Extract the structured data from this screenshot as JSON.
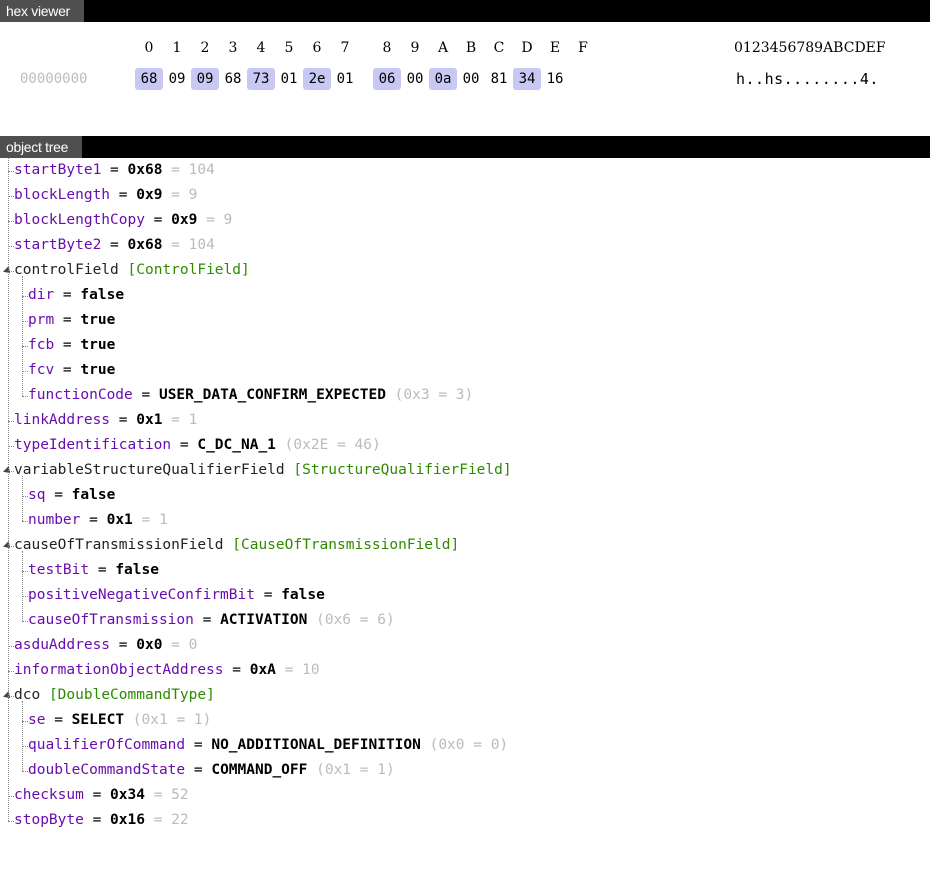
{
  "hex_viewer": {
    "title": "hex viewer",
    "columns": [
      "0",
      "1",
      "2",
      "3",
      "4",
      "5",
      "6",
      "7",
      "8",
      "9",
      "A",
      "B",
      "C",
      "D",
      "E",
      "F"
    ],
    "ascii_header": "0123456789ABCDEF",
    "offset": "00000000",
    "bytes": [
      "68",
      "09",
      "09",
      "68",
      "73",
      "01",
      "2e",
      "01",
      "06",
      "00",
      "0a",
      "00",
      "81",
      "34",
      "16"
    ],
    "ascii": "h..hs........4."
  },
  "object_tree": {
    "title": "object tree",
    "nodes": [
      {
        "key": "startByte1",
        "eq": " = ",
        "val": "0x68",
        "num": " = 104"
      },
      {
        "key": "blockLength",
        "eq": " = ",
        "val": "0x9",
        "num": " = 9"
      },
      {
        "key": "blockLengthCopy",
        "eq": " = ",
        "val": "0x9",
        "num": " = 9"
      },
      {
        "key": "startByte2",
        "eq": " = ",
        "val": "0x68",
        "num": " = 104"
      },
      {
        "key": "controlField",
        "type": "[ControlField]"
      },
      {
        "key": "dir",
        "eq": " = ",
        "val": "false"
      },
      {
        "key": "prm",
        "eq": " = ",
        "val": "true"
      },
      {
        "key": "fcb",
        "eq": " = ",
        "val": "true"
      },
      {
        "key": "fcv",
        "eq": " = ",
        "val": "true"
      },
      {
        "key": "functionCode",
        "eq": " = ",
        "val": "USER_DATA_CONFIRM_EXPECTED",
        "num": " (0x3 = 3)"
      },
      {
        "key": "linkAddress",
        "eq": " = ",
        "val": "0x1",
        "num": " = 1"
      },
      {
        "key": "typeIdentification",
        "eq": " = ",
        "val": "C_DC_NA_1",
        "num": " (0x2E = 46)"
      },
      {
        "key": "variableStructureQualifierField",
        "type": "[StructureQualifierField]"
      },
      {
        "key": "sq",
        "eq": " = ",
        "val": "false"
      },
      {
        "key": "number",
        "eq": " = ",
        "val": "0x1",
        "num": " = 1"
      },
      {
        "key": "causeOfTransmissionField",
        "type": "[CauseOfTransmissionField]"
      },
      {
        "key": "testBit",
        "eq": " = ",
        "val": "false"
      },
      {
        "key": "positiveNegativeConfirmBit",
        "eq": " = ",
        "val": "false"
      },
      {
        "key": "causeOfTransmission",
        "eq": " = ",
        "val": "ACTIVATION",
        "num": " (0x6 = 6)"
      },
      {
        "key": "asduAddress",
        "eq": " = ",
        "val": "0x0",
        "num": " = 0"
      },
      {
        "key": "informationObjectAddress",
        "eq": " = ",
        "val": "0xA",
        "num": " = 10"
      },
      {
        "key": "dco",
        "type": "[DoubleCommandType]"
      },
      {
        "key": "se",
        "eq": " = ",
        "val": "SELECT",
        "num": " (0x1 = 1)"
      },
      {
        "key": "qualifierOfCommand",
        "eq": " = ",
        "val": "NO_ADDITIONAL_DEFINITION",
        "num": " (0x0 = 0)"
      },
      {
        "key": "doubleCommandState",
        "eq": " = ",
        "val": "COMMAND_OFF",
        "num": " (0x1 = 1)"
      },
      {
        "key": "checksum",
        "eq": " = ",
        "val": "0x34",
        "num": " = 52"
      },
      {
        "key": "stopByte",
        "eq": " = ",
        "val": "0x16",
        "num": " = 22"
      }
    ]
  }
}
